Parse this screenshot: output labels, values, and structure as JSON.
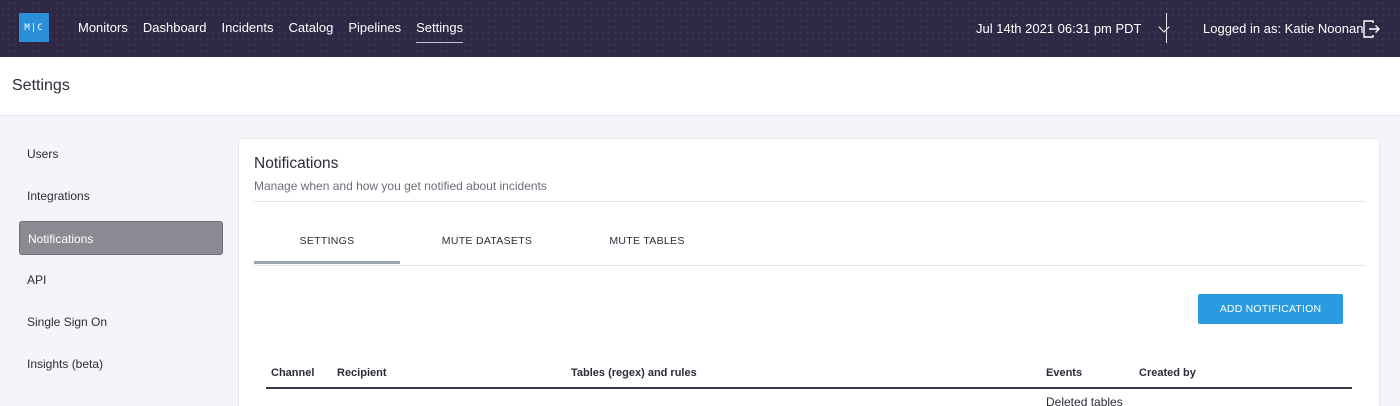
{
  "topbar": {
    "logo_text": "M|C",
    "nav": [
      "Monitors",
      "Dashboard",
      "Incidents",
      "Catalog",
      "Pipelines",
      "Settings"
    ],
    "active_nav": "Settings",
    "date": "Jul 14th 2021 06:31 pm PDT",
    "user": "Logged in as: Katie Noonan"
  },
  "page": {
    "title": "Settings"
  },
  "sidebar": {
    "items": [
      "Users",
      "Integrations",
      "Notifications",
      "API",
      "Single Sign On",
      "Insights (beta)"
    ],
    "active": "Notifications"
  },
  "card": {
    "title": "Notifications",
    "subtitle": "Manage when and how you get notified about incidents",
    "tabs": [
      "SETTINGS",
      "MUTE DATASETS",
      "MUTE TABLES"
    ],
    "active_tab": "SETTINGS",
    "add_button": "ADD NOTIFICATION",
    "columns": [
      "Channel",
      "Recipient",
      "Tables (regex) and rules",
      "Events",
      "Created by"
    ],
    "rows": [
      {
        "channel": "",
        "recipient": "",
        "tables": "",
        "events": "Deleted tables",
        "created_by": ""
      }
    ]
  },
  "colors": {
    "topbar": "#2f2844",
    "accent": "#2a9be0",
    "active_sidebar": "#8a8a93"
  }
}
